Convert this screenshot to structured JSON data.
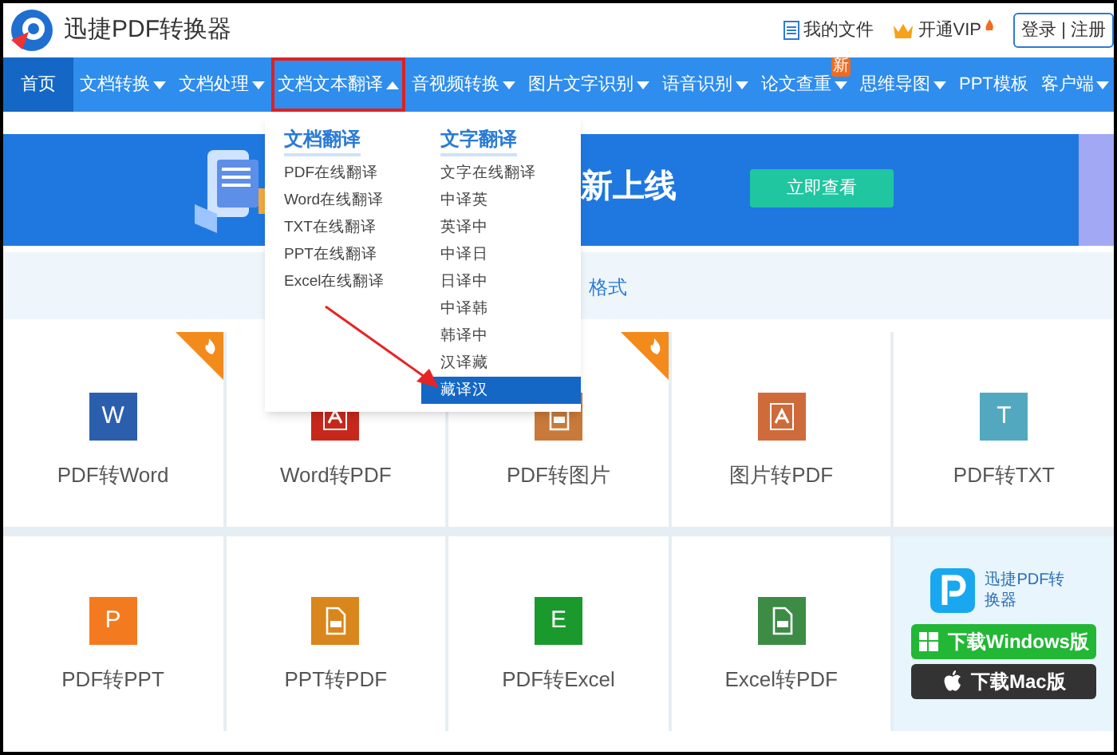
{
  "header": {
    "title": "迅捷PDF转换器",
    "links": [
      {
        "kind": "files",
        "label": "我的文件"
      },
      {
        "kind": "vip",
        "label": "开通VIP"
      }
    ],
    "login": "登录 | 注册"
  },
  "nav": [
    {
      "label": "首页",
      "selected": true,
      "has_menu": false,
      "highlighted": false
    },
    {
      "label": "文档转换",
      "selected": false,
      "has_menu": true,
      "expanded": false,
      "highlighted": false
    },
    {
      "label": "文档处理",
      "selected": false,
      "has_menu": true,
      "expanded": false,
      "highlighted": false
    },
    {
      "label": "文档文本翻译",
      "selected": false,
      "has_menu": true,
      "expanded": true,
      "highlighted": true
    },
    {
      "label": "音视频转换",
      "selected": false,
      "has_menu": true,
      "expanded": false,
      "highlighted": false
    },
    {
      "label": "图片文字识别",
      "selected": false,
      "has_menu": true,
      "expanded": false,
      "highlighted": false
    },
    {
      "label": "语音识别",
      "selected": false,
      "has_menu": true,
      "expanded": false,
      "highlighted": false
    },
    {
      "label": "论文查重",
      "selected": false,
      "has_menu": true,
      "expanded": false,
      "highlighted": false,
      "badge": "新"
    },
    {
      "label": "思维导图",
      "selected": false,
      "has_menu": true,
      "expanded": false,
      "highlighted": false
    },
    {
      "label": "PPT模板",
      "selected": false,
      "has_menu": false,
      "highlighted": false
    },
    {
      "label": "客户端",
      "selected": false,
      "has_menu": true,
      "expanded": false,
      "highlighted": false
    }
  ],
  "banner": {
    "headline": "新上线",
    "button": "立即查看"
  },
  "strip": {
    "text": "格式"
  },
  "dropdown": [
    {
      "title": "文档翻译",
      "items": [
        {
          "label": "PDF在线翻译",
          "selected": false
        },
        {
          "label": "Word在线翻译",
          "selected": false
        },
        {
          "label": "TXT在线翻译",
          "selected": false
        },
        {
          "label": "PPT在线翻译",
          "selected": false
        },
        {
          "label": "Excel在线翻译",
          "selected": false
        }
      ]
    },
    {
      "title": "文字翻译",
      "items": [
        {
          "label": "文字在线翻译",
          "selected": false
        },
        {
          "label": "中译英",
          "selected": false
        },
        {
          "label": "英译中",
          "selected": false
        },
        {
          "label": "中译日",
          "selected": false
        },
        {
          "label": "日译中",
          "selected": false
        },
        {
          "label": "中译韩",
          "selected": false
        },
        {
          "label": "韩译中",
          "selected": false
        },
        {
          "label": "汉译藏",
          "selected": false
        },
        {
          "label": "藏译汉",
          "selected": true
        }
      ]
    }
  ],
  "tiles": [
    {
      "kind": "tool",
      "label": "PDF转Word",
      "hot": true,
      "icon": {
        "kind": "letter",
        "letter": "W",
        "color": "#2b5fad"
      }
    },
    {
      "kind": "tool",
      "label": "Word转PDF",
      "hot": false,
      "icon": {
        "kind": "acrobat",
        "color": "#c8281c"
      }
    },
    {
      "kind": "tool",
      "label": "PDF转图片",
      "hot": true,
      "icon": {
        "kind": "doc",
        "color": "#c97a3a"
      }
    },
    {
      "kind": "tool",
      "label": "图片转PDF",
      "hot": false,
      "icon": {
        "kind": "acrobat",
        "color": "#cf6a3a"
      }
    },
    {
      "kind": "tool",
      "label": "PDF转TXT",
      "hot": false,
      "icon": {
        "kind": "letter",
        "letter": "T",
        "color": "#52a9bf"
      }
    },
    {
      "kind": "tool",
      "label": "PDF转PPT",
      "hot": false,
      "icon": {
        "kind": "letter",
        "letter": "P",
        "color": "#f47a20"
      }
    },
    {
      "kind": "tool",
      "label": "PPT转PDF",
      "hot": false,
      "icon": {
        "kind": "doc",
        "color": "#d9861c"
      }
    },
    {
      "kind": "tool",
      "label": "PDF转Excel",
      "hot": false,
      "icon": {
        "kind": "letter",
        "letter": "E",
        "color": "#1a9a2c"
      }
    },
    {
      "kind": "tool",
      "label": "Excel转PDF",
      "hot": false,
      "icon": {
        "kind": "doc",
        "color": "#3d8c46"
      }
    },
    {
      "kind": "promo",
      "app": "迅捷PDF转换器",
      "buttons": [
        {
          "kind": "windows",
          "label": "下载Windows版"
        },
        {
          "kind": "mac",
          "label": "下载Mac版"
        }
      ]
    }
  ]
}
